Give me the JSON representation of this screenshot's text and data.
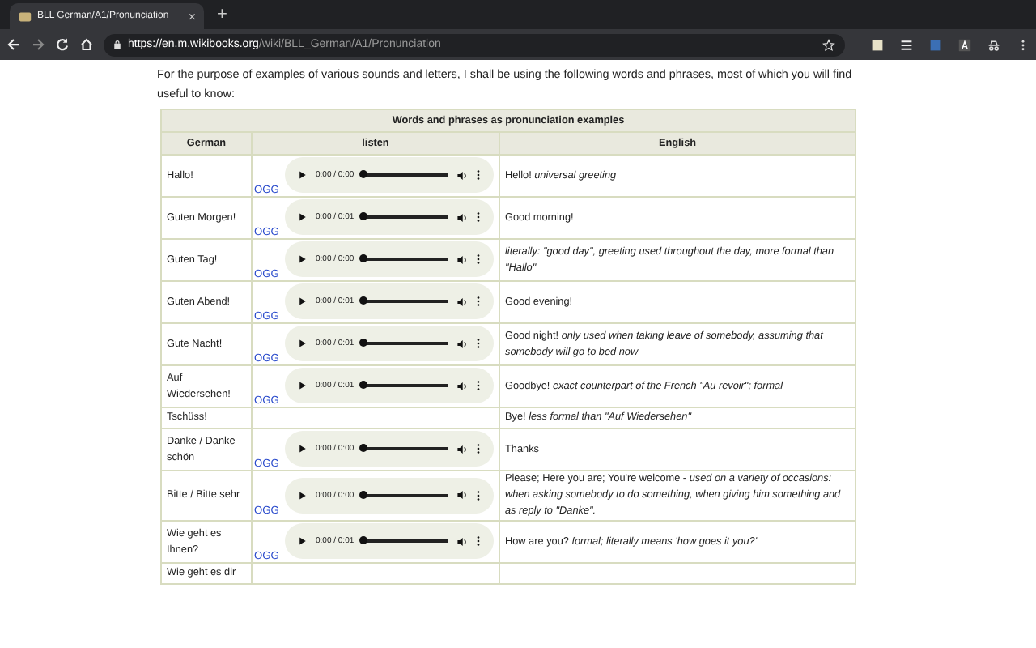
{
  "browser": {
    "tab": {
      "title": "BLL German/A1/Pronunciation",
      "close": "×"
    },
    "new_tab": "+",
    "address": {
      "host": "https://en.m.wikibooks.org",
      "path": "/wiki/BLL_German/A1/Pronunciation"
    }
  },
  "intro": "For the purpose of examples of various sounds and letters, I shall be using the following words and phrases, most of which you will find useful to know:",
  "table": {
    "caption": "Words and phrases as pronunciation examples",
    "columns": [
      "German",
      "listen",
      "English"
    ],
    "rows": [
      {
        "german": "Hallo!",
        "player": {
          "time": "0:00 / 0:00",
          "level": 0
        },
        "link": "OGG",
        "english": "Hello! *universal greeting*"
      },
      {
        "german": "Guten Morgen!",
        "player": {
          "time": "0:00 / 0:01",
          "level": 0
        },
        "link": "OGG",
        "english": "Good morning!"
      },
      {
        "german": "Guten Tag!",
        "player": {
          "time": "0:00 / 0:00",
          "level": 0
        },
        "link": "OGG",
        "english": "*literally: \"good day\", greeting used throughout the day, more formal than \"Hallo\"*"
      },
      {
        "german": "Guten Abend!",
        "player": {
          "time": "0:00 / 0:01",
          "level": 0
        },
        "link": "OGG",
        "english": "Good evening!"
      },
      {
        "german": "Gute Nacht!",
        "player": {
          "time": "0:00 / 0:01",
          "level": 0
        },
        "link": "OGG",
        "english": "Good night! *only used when taking leave of somebody, assuming that somebody will go to bed now*"
      },
      {
        "german": "Auf Wiedersehen!",
        "player": {
          "time": "0:00 / 0:01",
          "level": 0
        },
        "link": "OGG",
        "english": "Goodbye! *exact counterpart of the French \"Au revoir\"; formal*"
      },
      {
        "german": "Tschüss!",
        "english": "Bye! *less formal than \"Auf Wiedersehen\"*"
      },
      {
        "german": "Danke / Danke schön",
        "player": {
          "time": "0:00 / 0:00",
          "level": 0
        },
        "link": "OGG",
        "english": "Thanks"
      },
      {
        "german": "Bitte / Bitte sehr",
        "player": {
          "time": "0:00 / 0:00",
          "level": 0
        },
        "link": "OGG",
        "english": "Please; Here you are; You're welcome - *used on a variety of occasions: when asking somebody to do something, when giving him something and as reply to \"Danke\".*"
      },
      {
        "german": "Wie geht es Ihnen?",
        "player": {
          "time": "0:00 / 0:01",
          "level": 0
        },
        "link": "OGG",
        "english": "How are you? *formal; literally means 'how goes it you?'*"
      },
      {
        "german": "Wie geht es dir"
      }
    ]
  }
}
